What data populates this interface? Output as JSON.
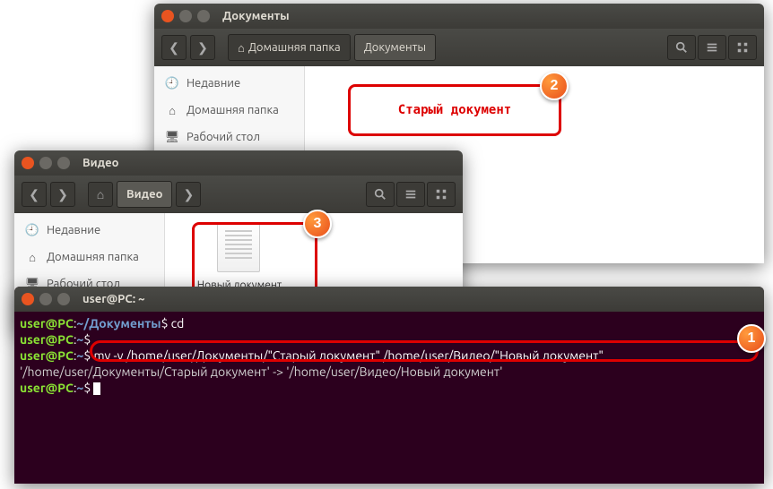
{
  "window1": {
    "title": "Документы",
    "breadcrumb_home": "Домашняя папка",
    "breadcrumb_current": "Документы",
    "sidebar": {
      "items": [
        {
          "icon": "clock",
          "label": "Недавние"
        },
        {
          "icon": "home",
          "label": "Домашняя папка"
        },
        {
          "icon": "desktop",
          "label": "Рабочий стол"
        }
      ]
    }
  },
  "window2": {
    "title": "Видео",
    "breadcrumb_home": "Видео",
    "sidebar": {
      "items": [
        {
          "icon": "clock",
          "label": "Недавние"
        },
        {
          "icon": "home",
          "label": "Домашняя папка"
        },
        {
          "icon": "desktop",
          "label": "Рабочий стол"
        }
      ]
    },
    "file_label": "Новый документ"
  },
  "highlight2_text": "Старый документ",
  "terminal": {
    "title": "user@PC: ~",
    "lines": {
      "l1_user": "user@PC",
      "l1_path": "~/Документы",
      "l1_cmd": "cd",
      "l2_user": "user@PC",
      "l2_path": "~",
      "l3_user": "user@PC",
      "l3_path": "~",
      "l3_cmd": "mv -v /home/user/Документы/\"Старый документ\" /home/user/Видео/\"Новый документ\"",
      "l4_out": "'/home/user/Документы/Старый документ' -> '/home/user/Видео/Новый документ'",
      "l5_user": "user@PC",
      "l5_path": "~"
    }
  },
  "callouts": {
    "c1": "1",
    "c2": "2",
    "c3": "3"
  }
}
